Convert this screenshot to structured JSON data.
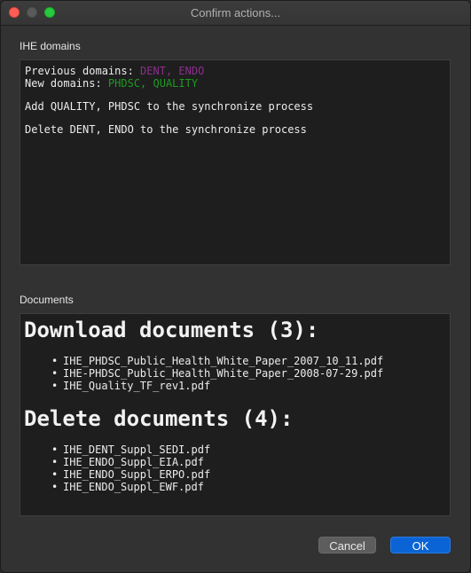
{
  "window": {
    "title": "Confirm actions..."
  },
  "domains": {
    "section_label": "IHE domains",
    "previous_label": "Previous domains: ",
    "previous_value": "DENT, ENDO",
    "new_label": "New domains: ",
    "new_value": "PHDSC, QUALITY",
    "add_line": "Add QUALITY, PHDSC to the synchronize process",
    "delete_line": "Delete DENT, ENDO to the synchronize process",
    "colors": {
      "previous": "#8b2f8b",
      "new": "#1f9a1f"
    }
  },
  "documents": {
    "section_label": "Documents",
    "download_heading": "Download documents (3):",
    "download_items": [
      "IHE_PHDSC_Public_Health_White_Paper_2007_10_11.pdf",
      "IHE-PHDSC_Public_Health_White_Paper_2008-07-29.pdf",
      "IHE_Quality_TF_rev1.pdf"
    ],
    "delete_heading": "Delete documents (4):",
    "delete_items": [
      "IHE_DENT_Suppl_SEDI.pdf",
      "IHE_ENDO_Suppl_EIA.pdf",
      "IHE_ENDO_Suppl_ERPO.pdf",
      "IHE_ENDO_Suppl_EWF.pdf"
    ],
    "bullet": "•"
  },
  "buttons": {
    "cancel": "Cancel",
    "ok": "OK"
  }
}
